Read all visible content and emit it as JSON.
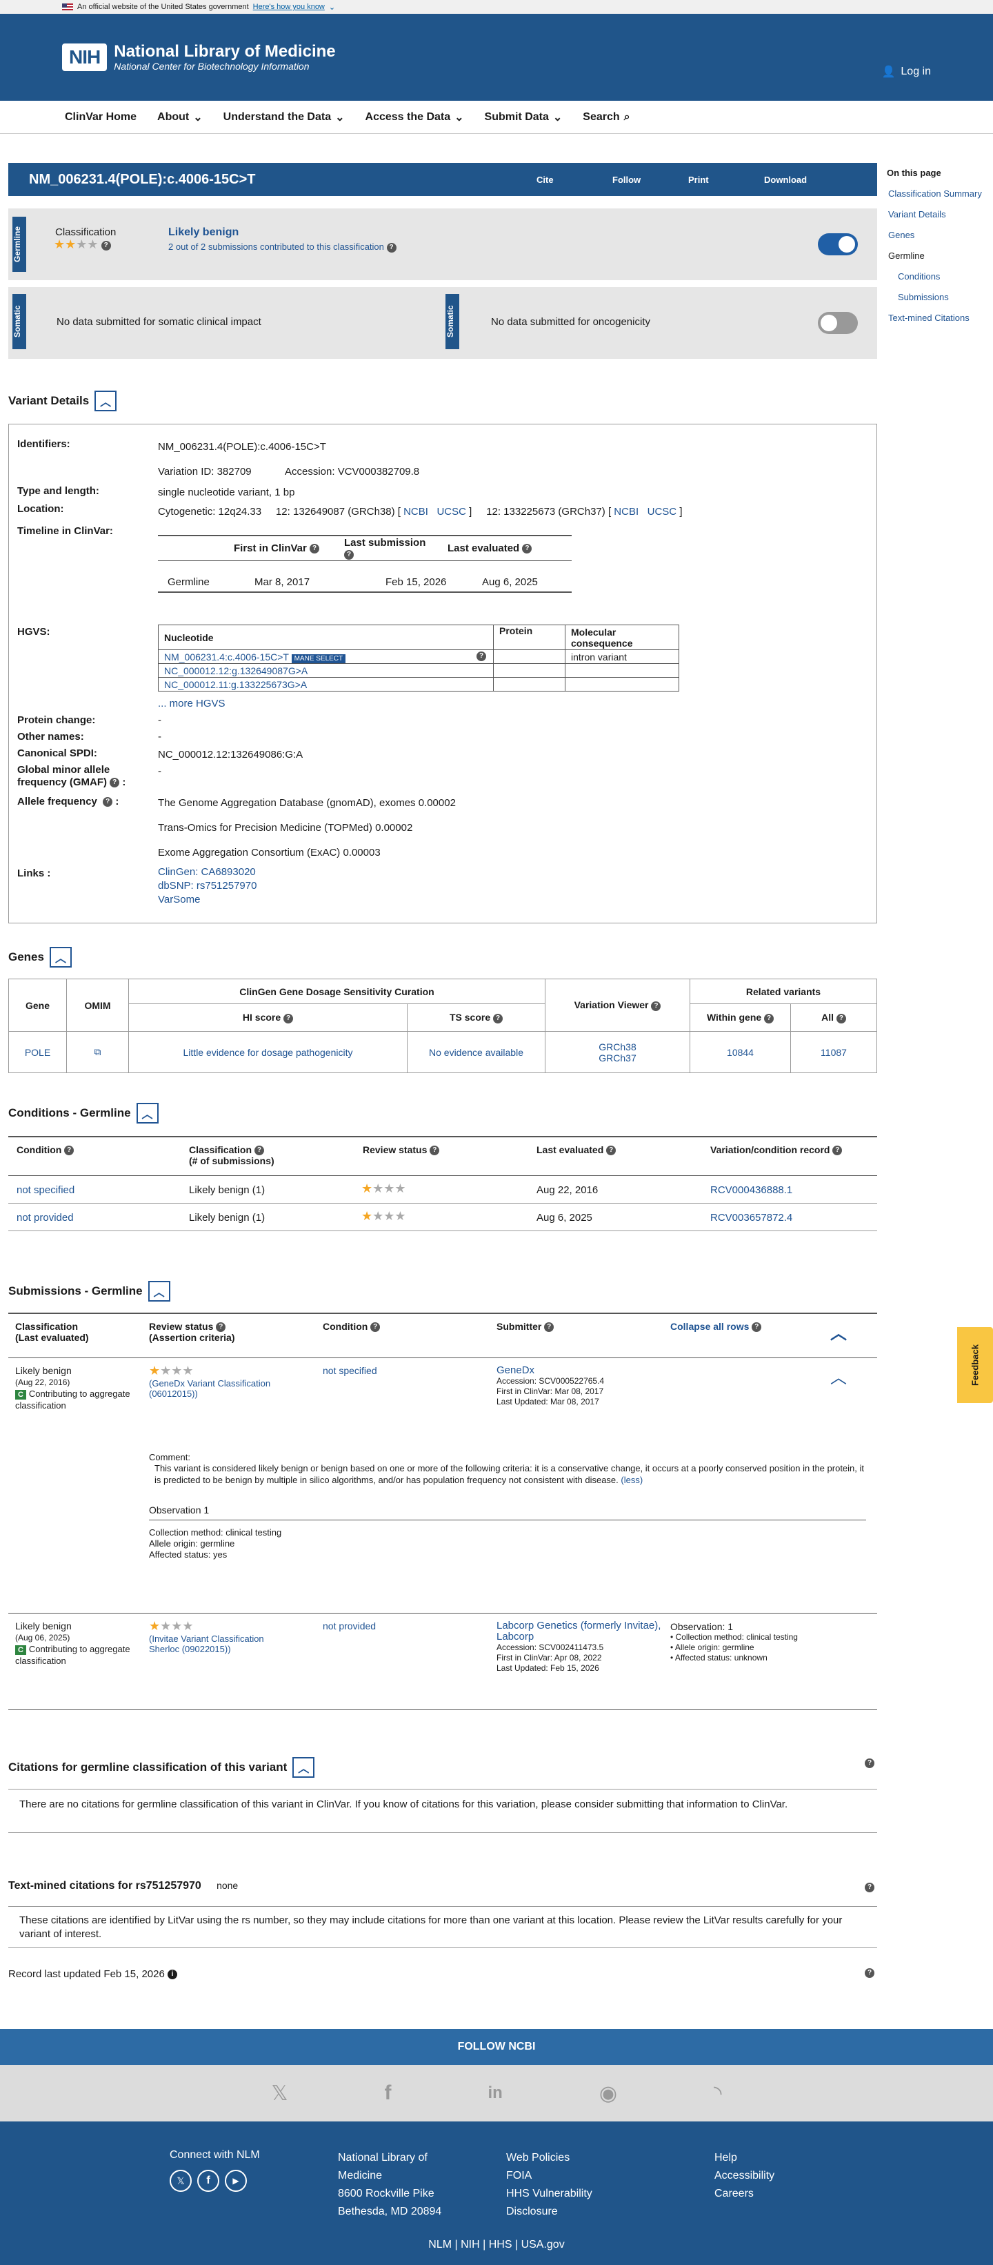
{
  "gov": {
    "text": "An official website of the United States government",
    "link": "Here's how you know"
  },
  "header": {
    "logo": "NIH",
    "title": "National Library of Medicine",
    "subtitle": "National Center for Biotechnology Information",
    "login": "Log in"
  },
  "nav": {
    "items": [
      "ClinVar Home",
      "About",
      "Understand the Data",
      "Access the Data",
      "Submit Data",
      "Search"
    ]
  },
  "variant": {
    "title": "NM_006231.4(POLE):c.4006-15C>T",
    "actions": [
      "Cite",
      "Follow",
      "Print",
      "Download"
    ]
  },
  "germline": {
    "tab": "Germline",
    "label": "Classification",
    "value": "Likely benign",
    "sub": "2 out of 2 submissions contributed to this classification"
  },
  "somatic": {
    "tab": "Somatic",
    "left": "No data submitted for somatic clinical impact",
    "right": "No data submitted for oncogenicity"
  },
  "details": {
    "heading": "Variant Details",
    "identifiers_label": "Identifiers:",
    "identifier": "NM_006231.4(POLE):c.4006-15C>T",
    "variation_id": "Variation ID: 382709",
    "accession": "Accession: VCV000382709.8",
    "type_label": "Type and length:",
    "type": "single nucleotide variant, 1 bp",
    "location_label": "Location:",
    "cytogenetic": "Cytogenetic: 12q24.33",
    "grch38": "12: 132649087 (GRCh38) [",
    "grch37": "12: 133225673 (GRCh37) [",
    "ncbi": "NCBI",
    "ucsc": "UCSC",
    "close": "]",
    "timeline_label": "Timeline in ClinVar:",
    "timeline_headers": [
      "First in ClinVar",
      "Last submission",
      "Last evaluated"
    ],
    "timeline_row": [
      "Germline",
      "Mar 8, 2017",
      "Feb 15, 2026",
      "Aug 6, 2025"
    ],
    "hgvs_label": "HGVS:",
    "hgvs_headers": [
      "Nucleotide",
      "Protein",
      "Molecular consequence"
    ],
    "hgvs_rows": [
      "NM_006231.4:c.4006-15C>T",
      "NC_000012.12:g.132649087G>A",
      "NC_000012.11:g.133225673G>A"
    ],
    "mane": "MANE SELECT",
    "consequence": "intron variant",
    "more_hgvs": "... more HGVS",
    "protein_label": "Protein change:",
    "protein": "-",
    "other_label": "Other names:",
    "other": "-",
    "spdi_label": "Canonical SPDI:",
    "spdi": "NC_000012.12:132649086:G:A",
    "gmaf_label": "Global minor allele frequency (GMAF)",
    "gmaf": "-",
    "af_label": "Allele frequency",
    "af": [
      "The Genome Aggregation Database (gnomAD), exomes 0.00002",
      "Trans-Omics for Precision Medicine (TOPMed) 0.00002",
      "Exome Aggregation Consortium (ExAC) 0.00003"
    ],
    "links_label": "Links :",
    "links": [
      "ClinGen: CA6893020",
      "dbSNP: rs751257970",
      "VarSome"
    ]
  },
  "genes": {
    "heading": "Genes",
    "headers": [
      "Gene",
      "OMIM",
      "ClinGen Gene Dosage Sensitivity Curation",
      "Variation Viewer",
      "Related variants"
    ],
    "sub": [
      "HI score",
      "TS score",
      "Within gene",
      "All"
    ],
    "row": {
      "gene": "POLE",
      "hi": "Little evidence for dosage pathogenicity",
      "ts": "No evidence available",
      "v1": "GRCh38",
      "v2": "GRCh37",
      "within": "10844",
      "all": "11087"
    }
  },
  "conditions": {
    "heading": "Conditions - Germline",
    "headers": [
      "Condition",
      "Classification",
      "(# of submissions)",
      "Review status",
      "Last evaluated",
      "Variation/condition record"
    ],
    "rows": [
      [
        "not specified",
        "Likely benign (1)",
        "Aug 22, 2016",
        "RCV000436888.1"
      ],
      [
        "not provided",
        "Likely benign (1)",
        "Aug 6, 2025",
        "RCV003657872.4"
      ]
    ]
  },
  "submissions": {
    "heading": "Submissions - Germline",
    "headers": [
      "Classification",
      "(Last evaluated)",
      "Review status",
      "(Assertion criteria)",
      "Condition",
      "Submitter",
      "Collapse all rows"
    ],
    "s1": {
      "cls": "Likely benign",
      "date": "(Aug 22, 2016)",
      "contrib": "Contributing to aggregate classification",
      "badge": "C",
      "review": "(GeneDx Variant Classification (06012015))",
      "cond": "not specified",
      "sub": "GeneDx",
      "acc": "Accession: SCV000522765.4",
      "first": "First in ClinVar: Mar 08, 2017",
      "updated": "Last Updated: Mar 08, 2017",
      "comment_label": "Comment:",
      "comment": "This variant is considered likely benign or benign based on one or more of the following criteria: it is a conservative change, it occurs at a poorly conserved position in the protein, it is predicted to be benign by multiple in silico algorithms, and/or has population frequency not consistent with disease.",
      "less": "(less)",
      "obs": "Observation 1",
      "obs_lines": [
        "Collection method: clinical testing",
        "Allele origin: germline",
        "Affected status: yes"
      ]
    },
    "s2": {
      "cls": "Likely benign",
      "date": "(Aug 06, 2025)",
      "contrib": "Contributing to aggregate classification",
      "badge": "C",
      "review": "(Invitae Variant Classification Sherloc (09022015))",
      "cond": "not provided",
      "sub": "Labcorp Genetics (formerly Invitae), Labcorp",
      "acc": "Accession: SCV002411473.5",
      "first": "First in ClinVar: Apr 08, 2022",
      "updated": "Last Updated: Feb 15, 2026",
      "obs": "Observation: 1",
      "obs_lines": [
        "Collection method: clinical testing",
        "Allele origin: germline",
        "Affected status: unknown"
      ]
    }
  },
  "citations": {
    "heading": "Citations for germline classification of this variant",
    "text": "There are no citations for germline classification of this variant in ClinVar. If you know of citations for this variation, please consider submitting that information to ClinVar."
  },
  "textmined": {
    "heading": "Text-mined citations for rs751257970",
    "none": "none",
    "text": "These citations are identified by LitVar using the rs number, so they may include citations for more than one variant at this location. Please review the LitVar results carefully for your variant of interest."
  },
  "record": "Record last updated Feb 15, 2026",
  "sidebar": {
    "heading": "On this page",
    "items": [
      "Classification Summary",
      "Variant Details",
      "Genes",
      "Germline",
      "Conditions",
      "Submissions",
      "Text-mined Citations"
    ]
  },
  "feedback": "Feedback",
  "follow": "FOLLOW NCBI",
  "footer": {
    "connect": "Connect with NLM",
    "nlm": [
      "National Library of",
      "Medicine",
      "8600 Rockville Pike",
      "Bethesda, MD 20894"
    ],
    "col3": [
      "Web Policies",
      "FOIA",
      "HHS Vulnerability",
      "Disclosure"
    ],
    "col4": [
      "Help",
      "Accessibility",
      "Careers"
    ],
    "bottom": [
      "NLM",
      "NIH",
      "HHS",
      "USA.gov"
    ]
  }
}
